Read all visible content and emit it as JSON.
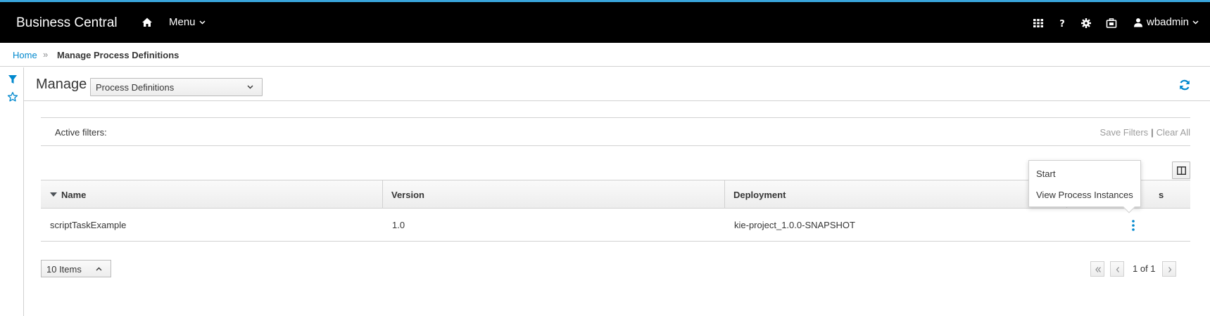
{
  "app": {
    "title": "Business Central",
    "menu_label": "Menu",
    "user_label": "wbadmin"
  },
  "icons": {
    "home": "home-icon",
    "apps": "grid-icon",
    "help": "question-icon",
    "settings": "gear-icon",
    "tasks": "briefcase-icon",
    "user": "user-icon",
    "filter": "filter-icon",
    "bookmark": "star-icon",
    "refresh": "refresh-icon",
    "columns": "columns-icon",
    "kebab": "kebab-icon"
  },
  "colors": {
    "accent": "#0088ce",
    "topline": "#39a5dc",
    "navbar": "#000000"
  },
  "breadcrumb": {
    "home": "Home",
    "separator": "»",
    "current": "Manage Process Definitions"
  },
  "manage": {
    "title": "Manage",
    "selected_view": "Process Definitions"
  },
  "filters": {
    "label": "Active filters:",
    "save": "Save Filters",
    "separator": "|",
    "clear": "Clear All"
  },
  "table": {
    "columns": [
      "Name",
      "Version",
      "Deployment",
      "Actions"
    ],
    "visible_header_fragment": "s",
    "rows": [
      {
        "name": "scriptTaskExample",
        "version": "1.0",
        "deployment": "kie-project_1.0.0-SNAPSHOT"
      }
    ]
  },
  "actions_menu": {
    "items": [
      "Start",
      "View Process Instances"
    ]
  },
  "pagination": {
    "page_size": "10 Items",
    "page_info": "1 of 1"
  }
}
